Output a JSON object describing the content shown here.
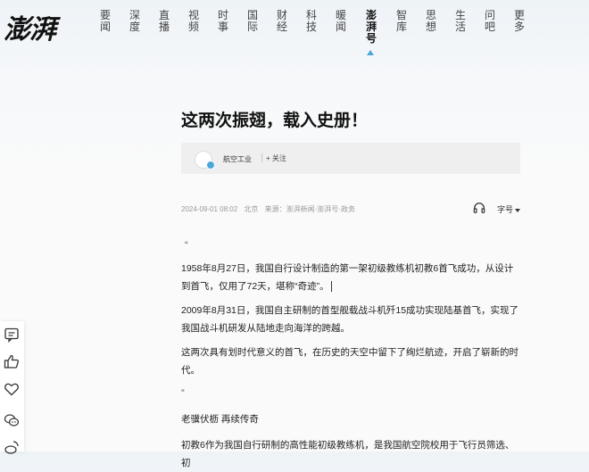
{
  "brand": {
    "logo_text": "澎湃"
  },
  "nav": {
    "items": [
      {
        "label": "要闻"
      },
      {
        "label": "深度"
      },
      {
        "label": "直播"
      },
      {
        "label": "视频"
      },
      {
        "label": "时事"
      },
      {
        "label": "国际"
      },
      {
        "label": "财经"
      },
      {
        "label": "科技"
      },
      {
        "label": "暖闻"
      },
      {
        "label": "澎湃号",
        "active": true
      },
      {
        "label": "智库"
      },
      {
        "label": "思想"
      },
      {
        "label": "生活"
      },
      {
        "label": "问吧"
      },
      {
        "label": "更多"
      }
    ]
  },
  "article": {
    "title": "这两次振翅，载入史册！",
    "author": {
      "name": "航空工业",
      "follow_label": "+ 关注"
    },
    "meta": {
      "date": "2024-09-01 08:02",
      "location": "北京",
      "source": "来源：澎湃新闻·澎湃号·政务"
    },
    "font_size_label": "字号",
    "open_quote": "“",
    "close_quote": "”",
    "paragraphs": [
      "1958年8月27日，我国自行设计制造的第一架初级教练机初教6首飞成功，从设计到首飞，仅用了72天，堪称“奇迹”。",
      "2009年8月31日，我国自主研制的首型舰载战斗机歼15成功实现陆基首飞，实现了我国战斗机研发从陆地走向海洋的跨越。",
      "这两次具有划时代意义的首飞，在历史的天空中留下了绚烂航迹，开启了崭新的时代。"
    ],
    "subheading": "老骥伏枥 再续传奇",
    "last_paragraph": "初教6作为我国自行研制的高性能初级教练机，是我国航空院校用于飞行员筛选、初"
  },
  "sidebar": {
    "icons": [
      "comment-icon",
      "like-icon",
      "favorite-icon",
      "share-wechat-icon",
      "share-weibo-icon"
    ]
  },
  "colors": {
    "accent": "#4aa8d8",
    "text": "#222222",
    "meta": "#999999"
  }
}
